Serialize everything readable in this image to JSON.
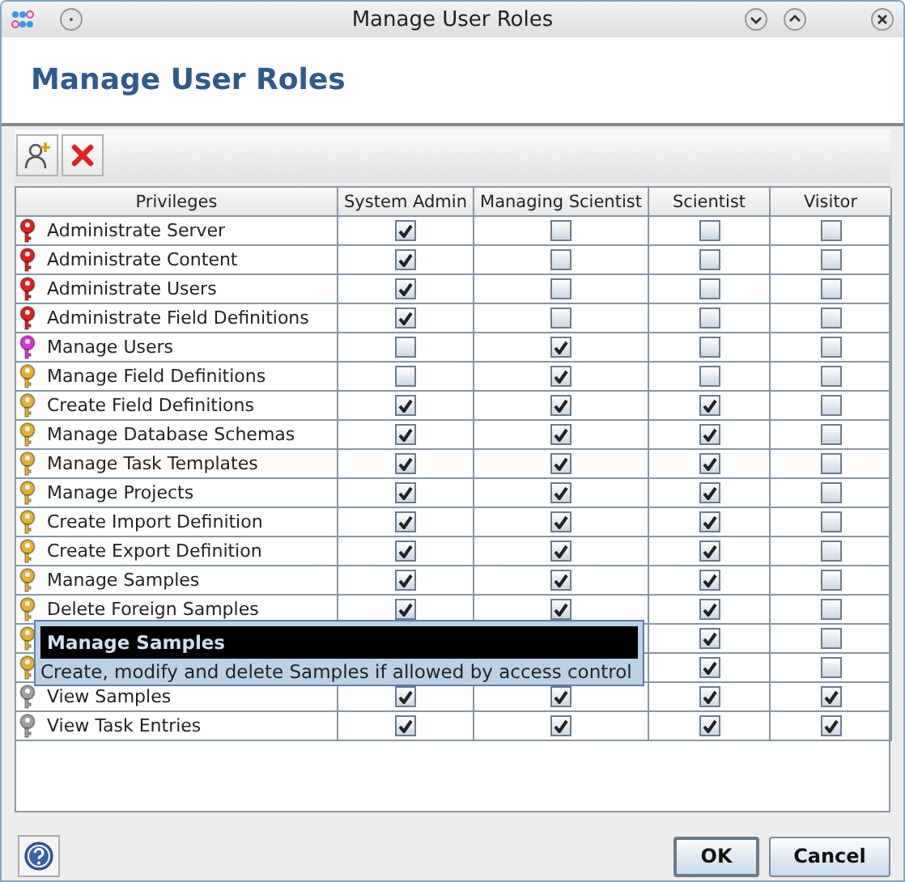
{
  "window": {
    "title": "Manage User Roles"
  },
  "header": {
    "title": "Manage User Roles"
  },
  "table": {
    "columns": [
      "Privileges",
      "System Admin",
      "Managing Scientist",
      "Scientist",
      "Visitor"
    ],
    "rows": [
      {
        "label": "Administrate Server",
        "color": "#e02020",
        "cells": [
          {
            "checked": true
          },
          {
            "checked": false
          },
          {
            "checked": false
          },
          {
            "checked": false
          }
        ]
      },
      {
        "label": "Administrate Content",
        "color": "#e02020",
        "cells": [
          {
            "checked": true
          },
          {
            "checked": false
          },
          {
            "checked": false
          },
          {
            "checked": false
          }
        ]
      },
      {
        "label": "Administrate Users",
        "color": "#e02020",
        "cells": [
          {
            "checked": true
          },
          {
            "checked": false
          },
          {
            "checked": false
          },
          {
            "checked": false
          }
        ]
      },
      {
        "label": "Administrate Field Definitions",
        "color": "#e02020",
        "cells": [
          {
            "checked": true
          },
          {
            "checked": false
          },
          {
            "checked": false
          },
          {
            "checked": false
          }
        ]
      },
      {
        "label": "Manage Users",
        "color": "#e030e0",
        "cells": [
          {
            "checked": false
          },
          {
            "checked": true
          },
          {
            "checked": false
          },
          {
            "checked": false
          }
        ]
      },
      {
        "label": "Manage Field Definitions",
        "color": "#e8b030",
        "cells": [
          {
            "checked": false
          },
          {
            "checked": true
          },
          {
            "checked": false
          },
          {
            "checked": false
          }
        ]
      },
      {
        "label": "Create Field Definitions",
        "color": "#e8b030",
        "cells": [
          {
            "checked": true
          },
          {
            "checked": true
          },
          {
            "checked": true
          },
          {
            "checked": false
          }
        ]
      },
      {
        "label": "Manage Database Schemas",
        "color": "#e8b030",
        "cells": [
          {
            "checked": true
          },
          {
            "checked": true
          },
          {
            "checked": true
          },
          {
            "checked": false
          }
        ]
      },
      {
        "label": "Manage Task Templates",
        "color": "#e8b030",
        "cells": [
          {
            "checked": true
          },
          {
            "checked": true
          },
          {
            "checked": true
          },
          {
            "checked": false
          }
        ]
      },
      {
        "label": "Manage Projects",
        "color": "#e8b030",
        "cells": [
          {
            "checked": true
          },
          {
            "checked": true
          },
          {
            "checked": true
          },
          {
            "checked": false
          }
        ]
      },
      {
        "label": "Create Import Definition",
        "color": "#e8b030",
        "cells": [
          {
            "checked": true
          },
          {
            "checked": true
          },
          {
            "checked": true
          },
          {
            "checked": false
          }
        ]
      },
      {
        "label": "Create Export Definition",
        "color": "#e8b030",
        "cells": [
          {
            "checked": true
          },
          {
            "checked": true
          },
          {
            "checked": true
          },
          {
            "checked": false
          }
        ]
      },
      {
        "label": "Manage Samples",
        "color": "#e8b030",
        "cells": [
          {
            "checked": true
          },
          {
            "checked": true
          },
          {
            "checked": true
          },
          {
            "checked": false
          }
        ]
      },
      {
        "label": "Delete Foreign Samples",
        "color": "#e8b030",
        "cells": [
          {
            "checked": true
          },
          {
            "checked": true
          },
          {
            "checked": true
          },
          {
            "checked": false
          }
        ]
      },
      {
        "color": "#e8b030",
        "cells": [
          null,
          null,
          {
            "checked": true
          },
          {
            "checked": false
          }
        ]
      },
      {
        "color": "#e8b030",
        "cells": [
          null,
          null,
          {
            "checked": true
          },
          {
            "checked": false
          }
        ]
      },
      {
        "label": "View Samples",
        "color": "#a0a0a0",
        "cells": [
          {
            "checked": true
          },
          {
            "checked": true
          },
          {
            "checked": true
          },
          {
            "checked": true
          }
        ]
      },
      {
        "label": "View Task Entries",
        "color": "#a0a0a0",
        "cells": [
          {
            "checked": true
          },
          {
            "checked": true
          },
          {
            "checked": true
          },
          {
            "checked": true
          }
        ]
      }
    ]
  },
  "tooltip": {
    "title": "Manage Samples",
    "text": "Create, modify and delete Samples if allowed by access control"
  },
  "buttons": [
    "OK",
    "Cancel"
  ]
}
